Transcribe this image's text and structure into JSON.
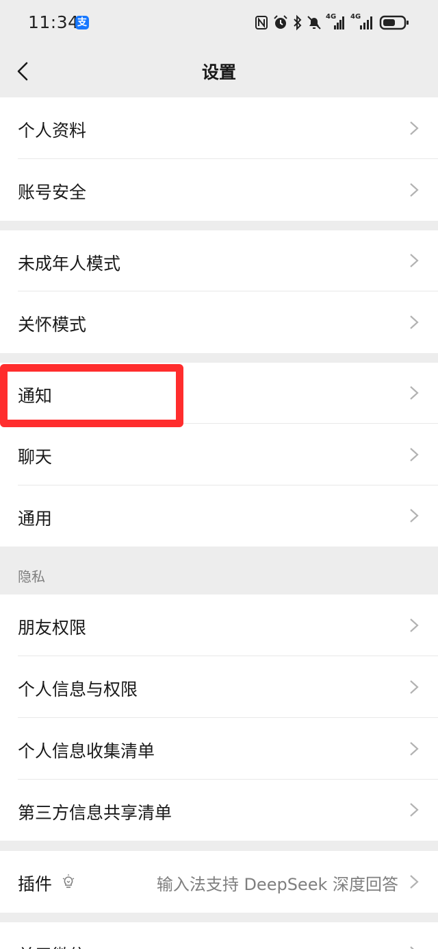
{
  "status_bar": {
    "time": "11:34",
    "badge": "支",
    "icons": [
      "nfc-icon",
      "alarm-icon",
      "bluetooth-icon",
      "mute-bell-icon",
      "signal-4g-icon",
      "signal-4g-icon",
      "battery-icon"
    ],
    "network_label_1": "4G",
    "network_label_2": "4G"
  },
  "nav": {
    "title": "设置",
    "back_icon": "chevron-left-icon"
  },
  "groups": {
    "g1": [
      "个人资料",
      "账号安全"
    ],
    "g2": [
      "未成年人模式",
      "关怀模式"
    ],
    "g3": [
      "通知",
      "聊天",
      "通用"
    ],
    "privacy_header": "隐私",
    "g4": [
      "朋友权限",
      "个人信息与权限",
      "个人信息收集清单",
      "第三方信息共享清单"
    ],
    "plugin": {
      "label": "插件",
      "value": "输入法支持 DeepSeek 深度回答",
      "icon": "lightbulb-icon"
    },
    "about": "关于微信"
  },
  "colors": {
    "background": "#ededed",
    "row": "#ffffff",
    "highlight": "#ff2d2d",
    "secondary_text": "#7f7f7f",
    "alipay_blue": "#1677ff"
  }
}
